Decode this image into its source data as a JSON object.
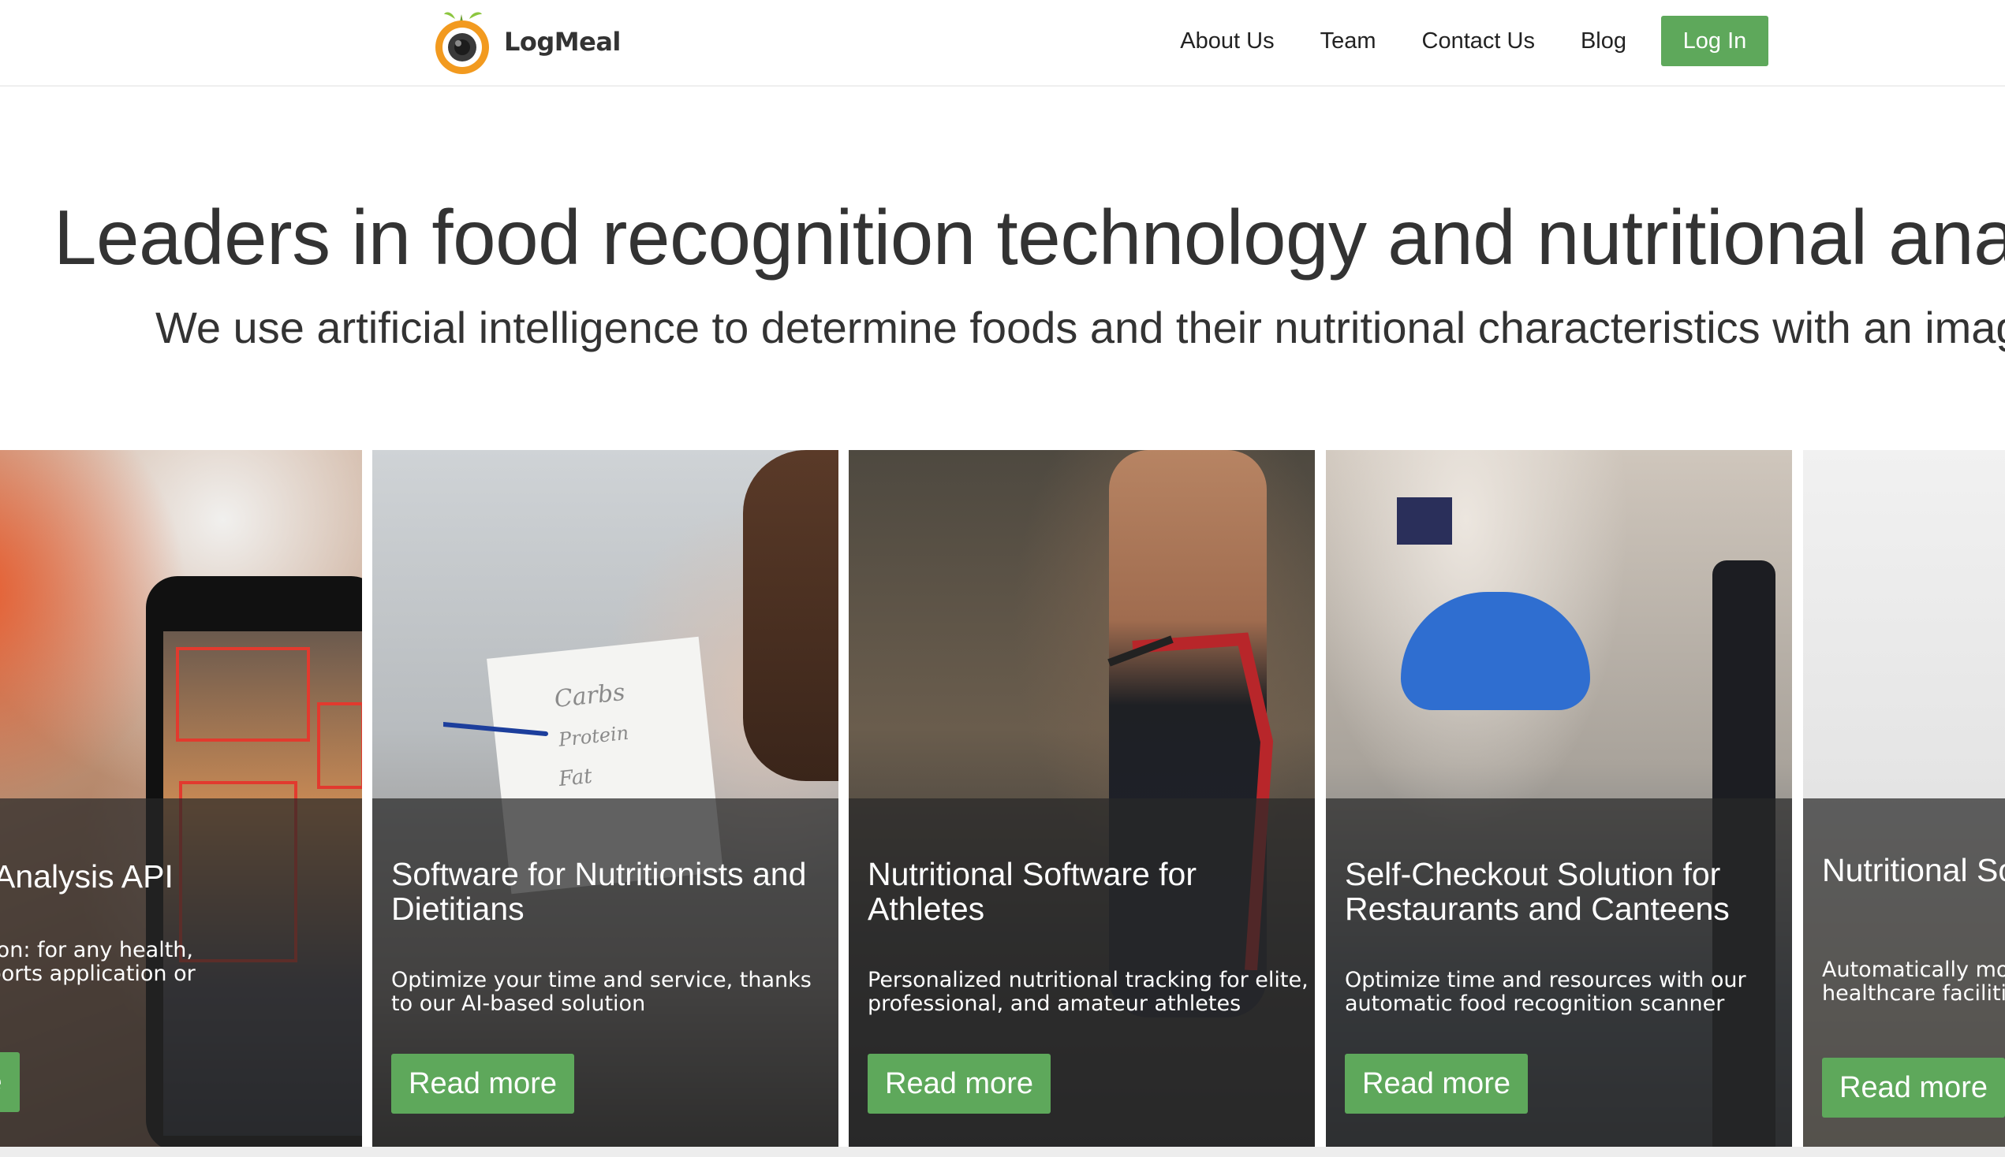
{
  "header": {
    "logo_text": "LogMeal",
    "nav": [
      {
        "label": "About Us"
      },
      {
        "label": "Team"
      },
      {
        "label": "Contact Us"
      },
      {
        "label": "Blog"
      }
    ],
    "login_label": "Log In"
  },
  "hero": {
    "title": "Leaders in food recognition technology and nutritional analy",
    "subtitle": "We use artificial intelligence to determine foods and their nutritional characteristics with an image."
  },
  "cards": [
    {
      "title": "rition Analysis API",
      "description": "ntification: for any health,\n, and sports application or",
      "button": "more"
    },
    {
      "title": "Software for Nutritionists and Dietitians",
      "description": "Optimize your time and service, thanks to our AI-based solution",
      "button": "Read more",
      "paper_notes": [
        "Carbs",
        "Protein",
        "Fat"
      ]
    },
    {
      "title": "Nutritional Software for Athletes",
      "description": "Personalized nutritional tracking for elite, professional, and amateur athletes",
      "button": "Read more"
    },
    {
      "title": "Self-Checkout Solution for Restaurants and Canteens",
      "description": "Optimize time and resources with our automatic food recognition scanner",
      "button": "Read more"
    },
    {
      "title": "Nutritional So Hospitals",
      "description": "Automatically mon patients both insid healthcare facilitie",
      "button": "Read more"
    }
  ],
  "colors": {
    "accent_green": "#5ea85b",
    "text_dark": "#333333",
    "card_overlay": "rgba(40,40,40,0.72)",
    "logo_orange": "#f29a1f",
    "logo_green": "#8cc63f"
  }
}
